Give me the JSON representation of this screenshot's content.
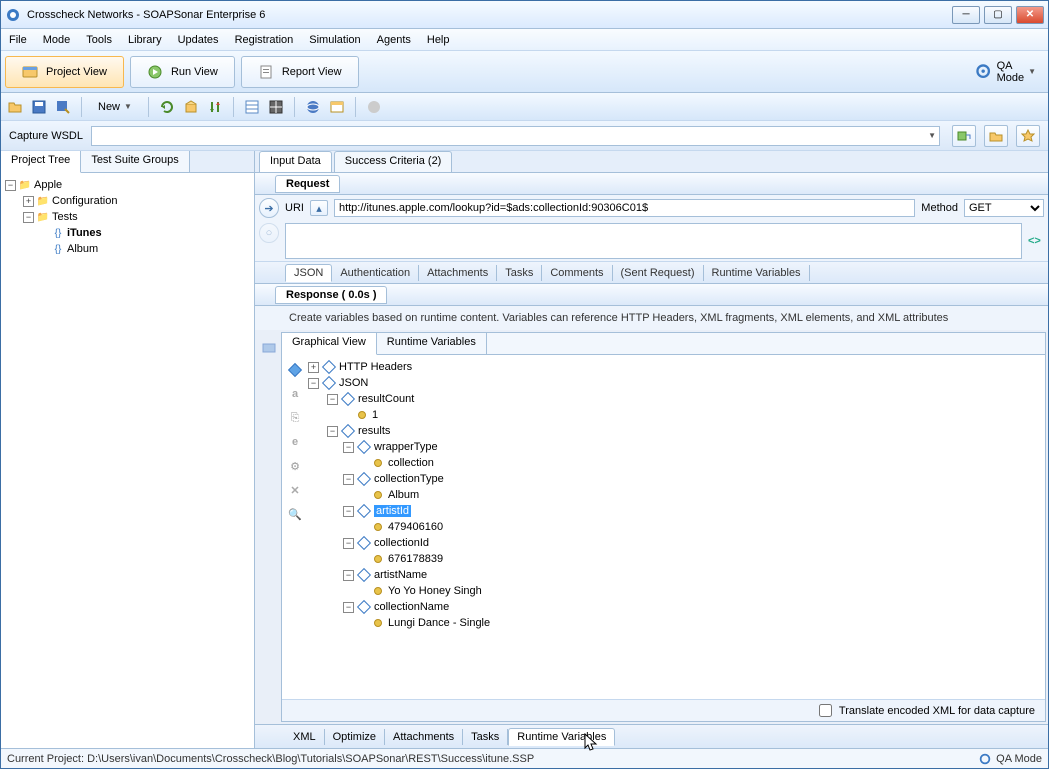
{
  "window": {
    "title": "Crosscheck Networks - SOAPSonar Enterprise 6"
  },
  "menu": [
    "File",
    "Mode",
    "Tools",
    "Library",
    "Updates",
    "Registration",
    "Simulation",
    "Agents",
    "Help"
  ],
  "views": {
    "project": "Project View",
    "run": "Run View",
    "report": "Report View",
    "qa": "QA Mode"
  },
  "toolbar": {
    "new_label": "New"
  },
  "wsdl": {
    "label": "Capture WSDL"
  },
  "left": {
    "tabs": {
      "project": "Project Tree",
      "suite": "Test Suite Groups"
    },
    "tree": {
      "root": "Apple",
      "config": "Configuration",
      "tests": "Tests",
      "itunes": "iTunes",
      "album": "Album"
    }
  },
  "right": {
    "tabs": {
      "input": "Input Data",
      "success": "Success Criteria (2)"
    },
    "request": {
      "label": "Request",
      "uri_label": "URI",
      "uri_value": "http://itunes.apple.com/lookup?id=$ads:collectionId:90306C01$",
      "method_label": "Method",
      "method_value": "GET"
    },
    "req_subtabs": [
      "JSON",
      "Authentication",
      "Attachments",
      "Tasks",
      "Comments",
      "(Sent Request)",
      "Runtime Variables"
    ],
    "response": {
      "label": "Response ( 0.0s )",
      "info": "Create variables based on runtime content.  Variables can reference HTTP Headers, XML fragments, XML elements, and XML attributes",
      "tabs": {
        "graph": "Graphical View",
        "runtime": "Runtime Variables"
      }
    },
    "gtree": {
      "http": "HTTP Headers",
      "json": "JSON",
      "resultCount": "resultCount",
      "resultCount_val": "1",
      "results": "results",
      "wrapperType": "wrapperType",
      "wrapperType_val": "collection",
      "collectionType": "collectionType",
      "collectionType_val": "Album",
      "artistId": "artistId",
      "artistId_val": "479406160",
      "collectionId": "collectionId",
      "collectionId_val": "676178839",
      "artistName": "artistName",
      "artistName_val": "Yo Yo Honey Singh",
      "collectionName": "collectionName",
      "collectionName_val": "Lungi Dance - Single"
    },
    "translate": "Translate encoded XML for data capture",
    "bottom_tabs": [
      "XML",
      "Optimize",
      "Attachments",
      "Tasks",
      "Runtime Variables"
    ]
  },
  "status": {
    "project": "Current Project: D:\\Users\\ivan\\Documents\\Crosscheck\\Blog\\Tutorials\\SOAPSonar\\REST\\Success\\itune.SSP",
    "mode": "QA Mode"
  }
}
